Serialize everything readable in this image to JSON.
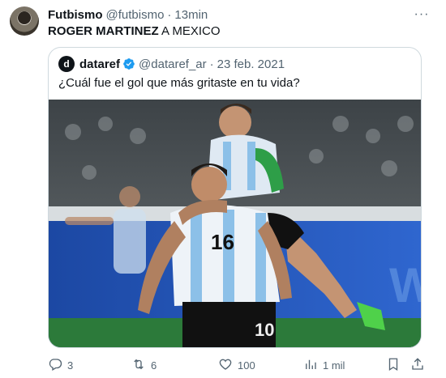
{
  "tweet": {
    "display_name": "Futbismo",
    "handle": "@futbismo",
    "separator": "·",
    "time": "13min",
    "text_strong": "ROGER MARTINEZ",
    "text_rest": " A MEXICO",
    "more_label": "···"
  },
  "quoted": {
    "avatar_letter": "d",
    "display_name": "dataref",
    "handle": "@dataref_ar",
    "separator": "·",
    "date": "23 feb. 2021",
    "text": "¿Cuál fue el gol que más gritaste en tu vida?",
    "jersey_front": "16",
    "jersey_back": "10"
  },
  "actions": {
    "reply_count": "3",
    "retweet_count": "6",
    "like_count": "100",
    "views_count": "1 mil"
  },
  "colors": {
    "text_primary": "#0f1419",
    "text_secondary": "#536471",
    "border": "#cfd9de",
    "verified": "#1d9bf0"
  },
  "icons": [
    "more-icon",
    "verified-icon",
    "reply-icon",
    "retweet-icon",
    "like-icon",
    "views-icon",
    "bookmark-icon",
    "share-icon"
  ]
}
